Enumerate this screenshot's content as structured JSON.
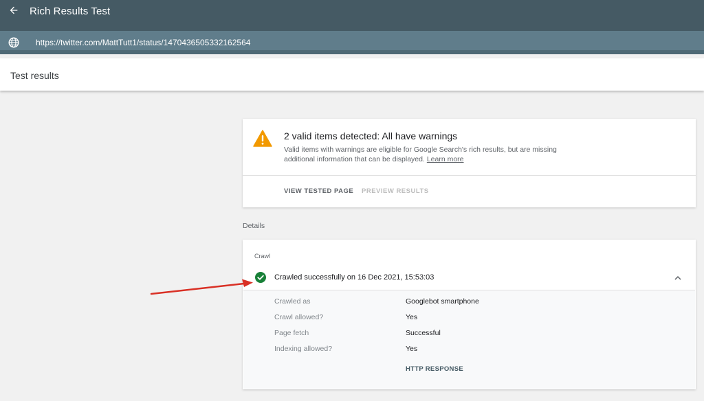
{
  "app": {
    "title": "Rich Results Test",
    "url": "https://twitter.com/MattTutt1/status/1470436505332162564"
  },
  "header": {
    "title": "Test results"
  },
  "summary": {
    "title": "2 valid items detected: All have warnings",
    "description": "Valid items with warnings are eligible for Google Search's rich results, but are missing additional information that can be displayed.",
    "learn_more": "Learn more",
    "tabs": [
      {
        "label": "VIEW TESTED PAGE",
        "enabled": true
      },
      {
        "label": "PREVIEW RESULTS",
        "enabled": false
      }
    ]
  },
  "details": {
    "label": "Details",
    "crawl": {
      "heading": "Crawl",
      "status": "Crawled successfully on 16 Dec 2021, 15:53:03",
      "rows": [
        {
          "label": "Crawled as",
          "value": "Googlebot smartphone"
        },
        {
          "label": "Crawl allowed?",
          "value": "Yes"
        },
        {
          "label": "Page fetch",
          "value": "Successful"
        },
        {
          "label": "Indexing allowed?",
          "value": "Yes"
        }
      ],
      "http_response": "HTTP RESPONSE"
    }
  },
  "icons": {
    "back": "arrow-back-icon",
    "globe": "globe-icon",
    "warning": "warning-icon",
    "check": "check-circle-icon",
    "chevron": "chevron-up-icon"
  },
  "colors": {
    "topbar": "#455a64",
    "urlbar": "#607d8b",
    "warning": "#f29900",
    "success": "#188038",
    "annotation_arrow": "#d93025"
  }
}
